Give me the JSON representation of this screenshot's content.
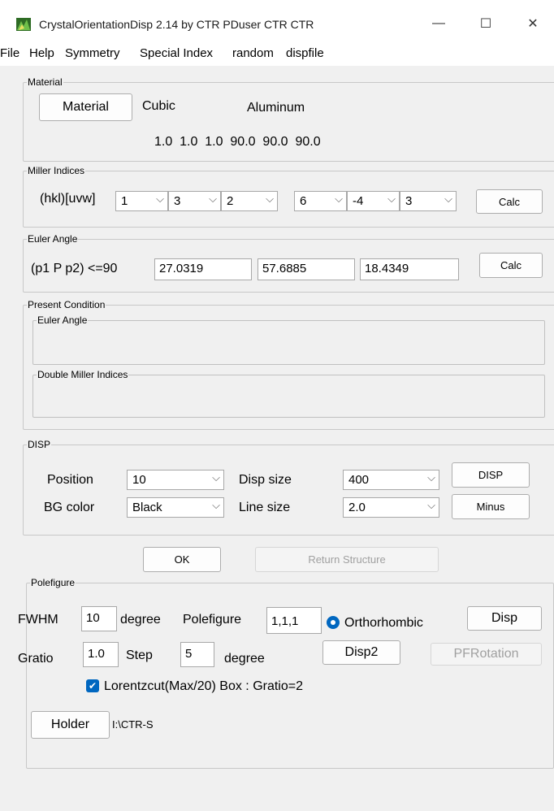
{
  "window": {
    "title": "CrystalOrientationDisp 2.14 by CTR PDuser CTR CTR",
    "minimize": "—",
    "maximize": "☐",
    "close": "✕"
  },
  "menu": [
    "File",
    "Help",
    "Symmetry",
    "Special Index",
    "random",
    "dispfile"
  ],
  "material": {
    "group": "Material",
    "button": "Material",
    "system": "Cubic",
    "name": "Aluminum",
    "lattice": "1.0  1.0  1.0  90.0  90.0  90.0"
  },
  "miller": {
    "group": "Miller Indices",
    "label": "(hkl)[uvw]",
    "values": [
      "1",
      "3",
      "2",
      "6",
      "-4",
      "3"
    ],
    "calc": "Calc"
  },
  "euler": {
    "group": "Euler Angle",
    "label": "(p1 P p2) <=90",
    "values": [
      "27.0319",
      "57.6885",
      "18.4349"
    ],
    "calc": "Calc"
  },
  "present": {
    "group": "Present Condition",
    "euler": "Euler Angle",
    "double_miller": "Double Miller Indices"
  },
  "disp": {
    "group": "DISP",
    "position_label": "Position",
    "position": "10",
    "size_label": "Disp size",
    "size": "400",
    "disp_button": "DISP",
    "bg_label": "BG color",
    "bg": "Black",
    "line_label": "Line size",
    "line": "2.0",
    "minus_button": "Minus"
  },
  "ok": "OK",
  "return_structure": "Return Structure",
  "pole": {
    "group": "Polefigure",
    "fwhm_label": "FWHM",
    "fwhm": "10",
    "degree1": "degree",
    "pf_label": "Polefigure",
    "pf": "1,1,1",
    "ortho": "Orthorhombic",
    "disp": "Disp",
    "gratio_label": "Gratio",
    "gratio": "1.0",
    "step_label": "Step",
    "step": "5",
    "degree2": "degree",
    "disp2": "Disp2",
    "pfrotation": "PFRotation",
    "lorentz": "Lorentzcut(Max/20) Box : Gratio=2",
    "holder": "Holder",
    "path": "I:\\CTR-S"
  },
  "colors": {
    "accent": "#0067c0",
    "icon_green": "#3a8a2c"
  }
}
